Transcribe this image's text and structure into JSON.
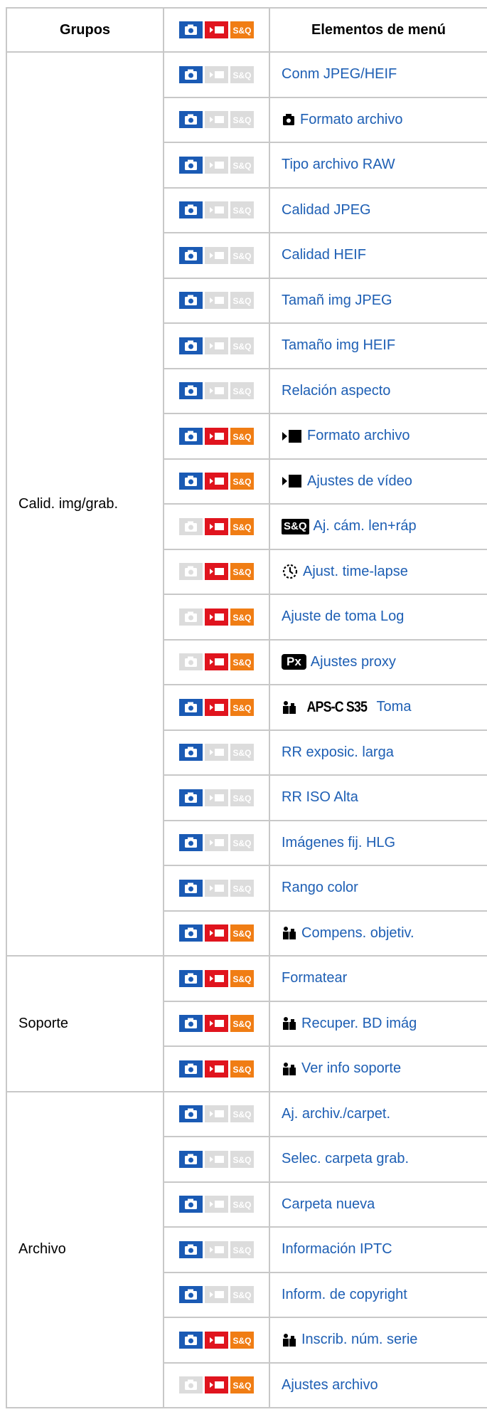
{
  "headers": {
    "groups": "Grupos",
    "modes": "",
    "items": "Elementos de menú"
  },
  "colors": {
    "photo_active": "#1a5ab4",
    "movie_active": "#e0141e",
    "sq_active": "#f07d14",
    "inactive": "#dcdcdc",
    "link": "#1e5fb4",
    "border": "#c8c8c8"
  },
  "groups": [
    {
      "label": "Calid. img/grab.",
      "rows": [
        {
          "modes": [
            1,
            0,
            0
          ],
          "prefix": [],
          "label": "Conm JPEG/HEIF"
        },
        {
          "modes": [
            1,
            0,
            0
          ],
          "prefix": [
            "photo-icon"
          ],
          "label": "Formato archivo"
        },
        {
          "modes": [
            1,
            0,
            0
          ],
          "prefix": [],
          "label": "Tipo archivo RAW"
        },
        {
          "modes": [
            1,
            0,
            0
          ],
          "prefix": [],
          "label": "Calidad JPEG"
        },
        {
          "modes": [
            1,
            0,
            0
          ],
          "prefix": [],
          "label": "Calidad HEIF"
        },
        {
          "modes": [
            1,
            0,
            0
          ],
          "prefix": [],
          "label": "Tamañ img JPEG"
        },
        {
          "modes": [
            1,
            0,
            0
          ],
          "prefix": [],
          "label": "Tamaño img HEIF"
        },
        {
          "modes": [
            1,
            0,
            0
          ],
          "prefix": [],
          "label": "Relación aspecto"
        },
        {
          "modes": [
            1,
            1,
            1
          ],
          "prefix": [
            "movie-icon"
          ],
          "label": "Formato archivo"
        },
        {
          "modes": [
            1,
            1,
            1
          ],
          "prefix": [
            "movie-icon"
          ],
          "label": "Ajustes de vídeo"
        },
        {
          "modes": [
            0,
            1,
            1
          ],
          "prefix": [
            "sq-icon"
          ],
          "label": "Aj. cám. len+ráp"
        },
        {
          "modes": [
            0,
            1,
            1
          ],
          "prefix": [
            "timelapse-icon"
          ],
          "label": "Ajust. time-lapse"
        },
        {
          "modes": [
            0,
            1,
            1
          ],
          "prefix": [],
          "label": "Ajuste de toma Log"
        },
        {
          "modes": [
            0,
            1,
            1
          ],
          "prefix": [
            "proxy-icon"
          ],
          "label": "Ajustes proxy"
        },
        {
          "modes": [
            1,
            1,
            1
          ],
          "prefix": [
            "custom-icon",
            "aps-icon"
          ],
          "label": "Toma"
        },
        {
          "modes": [
            1,
            0,
            0
          ],
          "prefix": [],
          "label": "RR exposic. larga"
        },
        {
          "modes": [
            1,
            0,
            0
          ],
          "prefix": [],
          "label": "RR ISO Alta"
        },
        {
          "modes": [
            1,
            0,
            0
          ],
          "prefix": [],
          "label": "Imágenes fij. HLG"
        },
        {
          "modes": [
            1,
            0,
            0
          ],
          "prefix": [],
          "label": "Rango color"
        },
        {
          "modes": [
            1,
            1,
            1
          ],
          "prefix": [
            "custom-icon"
          ],
          "label": "Compens. objetiv."
        }
      ]
    },
    {
      "label": "Soporte",
      "rows": [
        {
          "modes": [
            1,
            1,
            1
          ],
          "prefix": [],
          "label": "Formatear"
        },
        {
          "modes": [
            1,
            1,
            1
          ],
          "prefix": [
            "custom-icon"
          ],
          "label": "Recuper. BD imág"
        },
        {
          "modes": [
            1,
            1,
            1
          ],
          "prefix": [
            "custom-icon"
          ],
          "label": "Ver info soporte"
        }
      ]
    },
    {
      "label": "Archivo",
      "rows": [
        {
          "modes": [
            1,
            0,
            0
          ],
          "prefix": [],
          "label": "Aj. archiv./carpet."
        },
        {
          "modes": [
            1,
            0,
            0
          ],
          "prefix": [],
          "label": "Selec. carpeta grab."
        },
        {
          "modes": [
            1,
            0,
            0
          ],
          "prefix": [],
          "label": "Carpeta nueva"
        },
        {
          "modes": [
            1,
            0,
            0
          ],
          "prefix": [],
          "label": "Información IPTC"
        },
        {
          "modes": [
            1,
            0,
            0
          ],
          "prefix": [],
          "label": "Inform. de copyright"
        },
        {
          "modes": [
            1,
            1,
            1
          ],
          "prefix": [
            "custom-icon"
          ],
          "label": "Inscrib. núm. serie"
        },
        {
          "modes": [
            0,
            1,
            1
          ],
          "prefix": [],
          "label": "Ajustes archivo"
        }
      ]
    }
  ],
  "glyphs": {
    "sq": "S&Q",
    "proxy": "Px",
    "aps": "APS-C S35"
  }
}
